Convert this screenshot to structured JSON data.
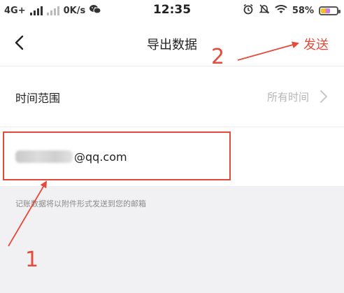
{
  "status_bar": {
    "network": "4G+",
    "speed": "0K/s",
    "time": "12:35",
    "battery": "58%",
    "battery_fraction": 0.58,
    "icons": [
      "signal-icon",
      "wechat-icon",
      "alarm-icon",
      "mute-icon",
      "wifi-icon",
      "battery-icon"
    ]
  },
  "nav": {
    "title": "导出数据",
    "send_label": "发送",
    "back_icon": "chevron-left-icon"
  },
  "range": {
    "label": "时间范围",
    "value": "所有时间"
  },
  "email": {
    "suffix": "@qq.com"
  },
  "hint": "记账数据将以附件形式发送到您的邮箱",
  "annotations": {
    "step1": "1",
    "step2": "2",
    "color": "#e54a3b"
  }
}
